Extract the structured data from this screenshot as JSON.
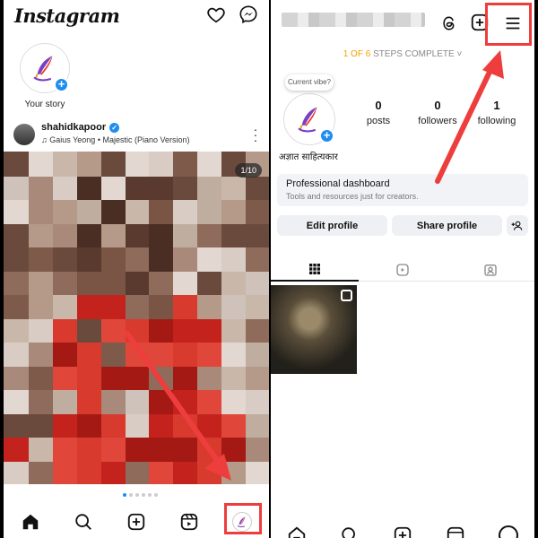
{
  "colors": {
    "accent": "#1d8df2",
    "highlight": "#ee3d3d",
    "steps_orange": "#f59f00"
  },
  "left": {
    "app_logo": "Instagram",
    "top_icons": [
      "heart-icon",
      "messenger-icon"
    ],
    "story": {
      "label": "Your story"
    },
    "post": {
      "username": "shahidkapoor",
      "verified_icon": "verified-check-icon",
      "music": "Gaius Yeong • Majestic (Piano Version)",
      "counter": "1/10",
      "carousel_dots": 6,
      "active_dot": 0
    },
    "bottom_nav": [
      "home-icon",
      "search-icon",
      "create-icon",
      "reels-icon",
      "profile-avatar"
    ]
  },
  "right": {
    "steps": {
      "done": "1 OF 6",
      "rest": "STEPS COMPLETE"
    },
    "top_icons": [
      "threads-icon",
      "create-icon",
      "menu-icon"
    ],
    "vibe_bubble": "Current vibe?",
    "profile_name": "अज्ञात साहित्यकार",
    "stats": [
      {
        "value": "0",
        "label": "posts"
      },
      {
        "value": "0",
        "label": "followers"
      },
      {
        "value": "1",
        "label": "following"
      }
    ],
    "pro_dashboard": {
      "title": "Professional dashboard",
      "subtitle": "Tools and resources just for creators."
    },
    "buttons": {
      "edit": "Edit profile",
      "share": "Share profile"
    },
    "tabs": [
      "grid-icon",
      "reels-icon",
      "tagged-icon"
    ],
    "bottom_nav": [
      "home-icon",
      "search-icon",
      "create-icon",
      "reels-icon",
      "profile-avatar"
    ]
  }
}
